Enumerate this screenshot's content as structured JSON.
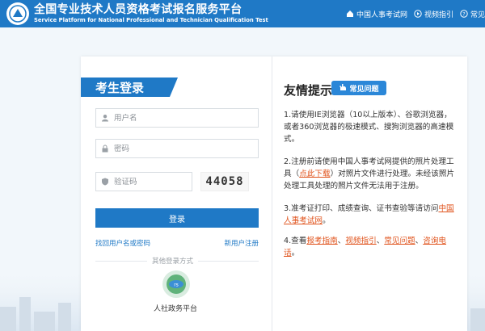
{
  "header": {
    "title": "全国专业技术人员资格考试报名服务平台",
    "subtitle": "Service Platform for National Professional and Technician Qualification Test",
    "nav": [
      {
        "label": "中国人事考试网",
        "icon": "home-icon"
      },
      {
        "label": "视频指引",
        "icon": "video-icon"
      },
      {
        "label": "常见",
        "icon": "question-icon"
      }
    ]
  },
  "login": {
    "title": "考生登录",
    "username_placeholder": "用户名",
    "password_placeholder": "密码",
    "captcha_placeholder": "验证码",
    "captcha_text": "44058",
    "login_button": "登录",
    "forgot_link": "找回用户名或密码",
    "register_link": "新用户注册",
    "other_methods": "其他登录方式",
    "gov_platform": "人社政务平台"
  },
  "notice": {
    "title": "友情提示",
    "faq_badge": "常见问题",
    "item1": "1.请使用IE浏览器（10以上版本）、谷歌浏览器，或者360浏览器的极速模式、搜狗浏览器的高速模式。",
    "item2_a": "2.注册前请使用中国人事考试网提供的照片处理工具（",
    "item2_link": "点此下载",
    "item2_b": "）对照片文件进行处理。未经该照片处理工具处理的照片文件无法用于注册。",
    "item3_a": "3.准考证打印、成绩查询、证书查验等请访问",
    "item3_link": "中国人事考试网",
    "item3_b": "。",
    "item4_a": "4.查看",
    "item4_links": [
      "报考指南",
      "视频指引",
      "常见问题",
      "咨询电话"
    ],
    "item4_sep": "、",
    "item4_end": "。"
  },
  "colors": {
    "brand": "#1f79c6",
    "link": "#e0531c"
  }
}
